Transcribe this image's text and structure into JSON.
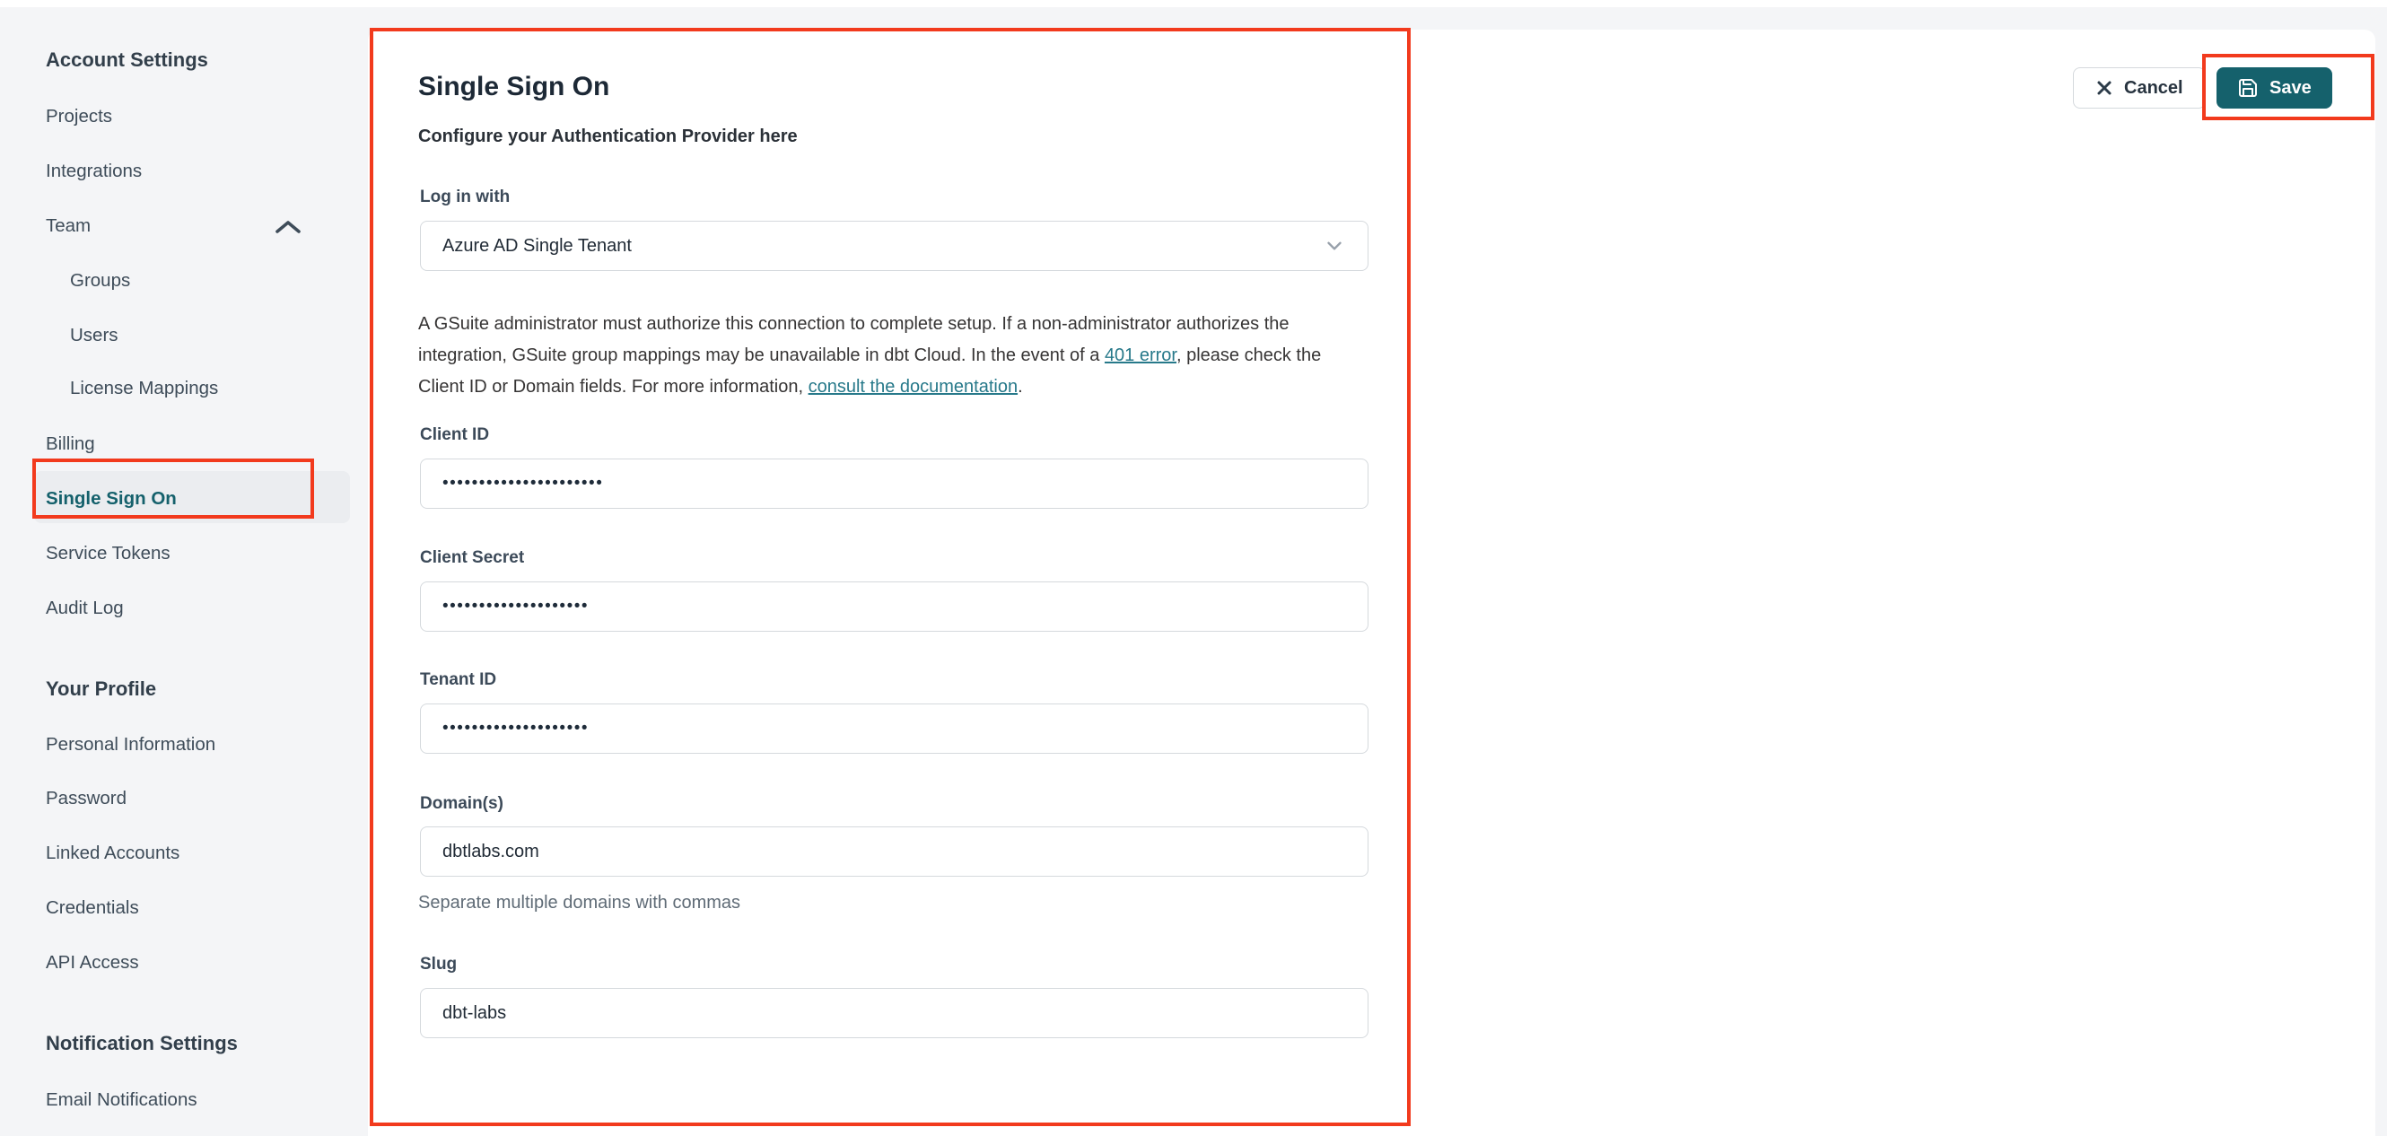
{
  "colors": {
    "accent_teal": "#15616c",
    "link_teal": "#27798a",
    "annotation_red": "#f23a1d",
    "panel_background": "#ffffff",
    "page_background": "#f4f5f7"
  },
  "sidebar": {
    "account_settings": {
      "header": "Account Settings",
      "projects": "Projects",
      "integrations": "Integrations",
      "team": "Team",
      "groups": "Groups",
      "users": "Users",
      "license_mappings": "License Mappings",
      "billing": "Billing",
      "single_sign_on": "Single Sign On",
      "service_tokens": "Service Tokens",
      "audit_log": "Audit Log"
    },
    "your_profile": {
      "header": "Your Profile",
      "personal_information": "Personal Information",
      "password": "Password",
      "linked_accounts": "Linked Accounts",
      "credentials": "Credentials",
      "api_access": "API Access"
    },
    "notification_settings": {
      "header": "Notification Settings",
      "email_notifications": "Email Notifications"
    },
    "active_item": "Single Sign On",
    "team_expanded": true
  },
  "main": {
    "title": "Single Sign On",
    "subtitle": "Configure your Authentication Provider here",
    "form": {
      "login_with": {
        "label": "Log in with",
        "value": "Azure AD Single Tenant"
      },
      "note": {
        "part1": "A GSuite administrator must authorize this connection to complete setup. If a non-administrator authorizes the integration, GSuite group mappings may be unavailable in dbt Cloud. In the event of a ",
        "link_401": "401 error",
        "part2": ", please check the Client ID or Domain fields. For more information, ",
        "link_docs": "consult the documentation",
        "part3": "."
      },
      "client_id": {
        "label": "Client ID",
        "value": "••••••••••••••••••••••"
      },
      "client_secret": {
        "label": "Client Secret",
        "value": "••••••••••••••••••••"
      },
      "tenant_id": {
        "label": "Tenant ID",
        "value": "••••••••••••••••••••"
      },
      "domains": {
        "label": "Domain(s)",
        "value": "dbtlabs.com",
        "helper": "Separate multiple domains with commas"
      },
      "slug": {
        "label": "Slug",
        "value": "dbt-labs"
      }
    },
    "actions": {
      "cancel": "Cancel",
      "save": "Save"
    }
  }
}
